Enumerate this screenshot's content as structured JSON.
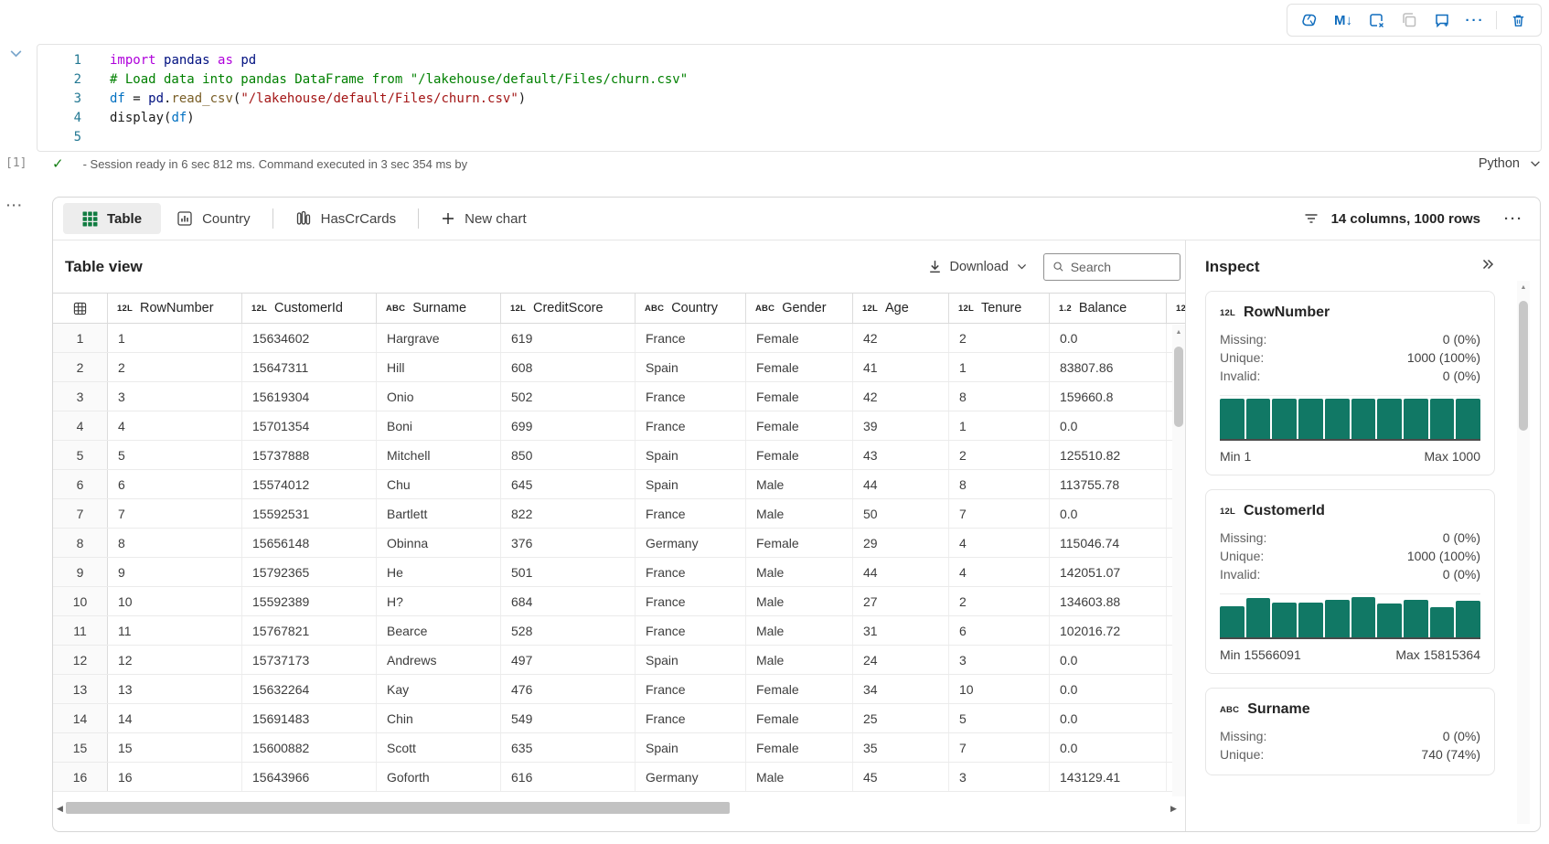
{
  "toolbar": {
    "markdown_label": "M↓",
    "more_label": "···"
  },
  "editor": {
    "lines": [
      {
        "n": "1",
        "tokens": [
          [
            "kw",
            "import"
          ],
          [
            "pl",
            " "
          ],
          [
            "mod",
            "pandas"
          ],
          [
            "pl",
            " "
          ],
          [
            "kw",
            "as"
          ],
          [
            "pl",
            " "
          ],
          [
            "mod",
            "pd"
          ]
        ]
      },
      {
        "n": "2",
        "tokens": [
          [
            "cm",
            "# Load data into pandas DataFrame from \"/lakehouse/default/Files/churn.csv\""
          ]
        ]
      },
      {
        "n": "3",
        "tokens": [
          [
            "var",
            "df"
          ],
          [
            "pl",
            " = "
          ],
          [
            "mod",
            "pd"
          ],
          [
            "pl",
            "."
          ],
          [
            "fn",
            "read_csv"
          ],
          [
            "pl",
            "("
          ],
          [
            "str",
            "\"/lakehouse/default/Files/churn.csv\""
          ],
          [
            "pl",
            ")"
          ]
        ]
      },
      {
        "n": "4",
        "tokens": [
          [
            "pl",
            "display("
          ],
          [
            "var",
            "df"
          ],
          [
            "pl",
            ")"
          ]
        ]
      },
      {
        "n": "5",
        "tokens": []
      }
    ],
    "exec_count": "[1]",
    "status_check": "✓",
    "status_message": "- Session ready in 6 sec 812 ms. Command executed in 3 sec 354 ms by",
    "kernel_label": "Python",
    "cell_more": "···"
  },
  "output": {
    "tabs": {
      "table": "Table",
      "country": "Country",
      "hascrcards": "HasCrCards",
      "new_chart": "New chart"
    },
    "summary_label": "14 columns, 1000 rows",
    "more_label": "···",
    "view": {
      "title": "Table view",
      "download_label": "Download",
      "search_placeholder": "Search"
    },
    "table": {
      "columns": [
        {
          "icon": "grid",
          "label": ""
        },
        {
          "icon": "12L",
          "label": "RowNumber"
        },
        {
          "icon": "12L",
          "label": "CustomerId"
        },
        {
          "icon": "ABC",
          "label": "Surname"
        },
        {
          "icon": "12L",
          "label": "CreditScore"
        },
        {
          "icon": "ABC",
          "label": "Country"
        },
        {
          "icon": "ABC",
          "label": "Gender"
        },
        {
          "icon": "12L",
          "label": "Age"
        },
        {
          "icon": "12L",
          "label": "Tenure"
        },
        {
          "icon": "1.2",
          "label": "Balance"
        },
        {
          "icon": "12L",
          "label": ""
        }
      ],
      "rows": [
        [
          "1",
          "15634602",
          "Hargrave",
          "619",
          "France",
          "Female",
          "42",
          "2",
          "0.0"
        ],
        [
          "2",
          "15647311",
          "Hill",
          "608",
          "Spain",
          "Female",
          "41",
          "1",
          "83807.86"
        ],
        [
          "3",
          "15619304",
          "Onio",
          "502",
          "France",
          "Female",
          "42",
          "8",
          "159660.8"
        ],
        [
          "4",
          "15701354",
          "Boni",
          "699",
          "France",
          "Female",
          "39",
          "1",
          "0.0"
        ],
        [
          "5",
          "15737888",
          "Mitchell",
          "850",
          "Spain",
          "Female",
          "43",
          "2",
          "125510.82"
        ],
        [
          "6",
          "15574012",
          "Chu",
          "645",
          "Spain",
          "Male",
          "44",
          "8",
          "113755.78"
        ],
        [
          "7",
          "15592531",
          "Bartlett",
          "822",
          "France",
          "Male",
          "50",
          "7",
          "0.0"
        ],
        [
          "8",
          "15656148",
          "Obinna",
          "376",
          "Germany",
          "Female",
          "29",
          "4",
          "115046.74"
        ],
        [
          "9",
          "15792365",
          "He",
          "501",
          "France",
          "Male",
          "44",
          "4",
          "142051.07"
        ],
        [
          "10",
          "15592389",
          "H?",
          "684",
          "France",
          "Male",
          "27",
          "2",
          "134603.88"
        ],
        [
          "11",
          "15767821",
          "Bearce",
          "528",
          "France",
          "Male",
          "31",
          "6",
          "102016.72"
        ],
        [
          "12",
          "15737173",
          "Andrews",
          "497",
          "Spain",
          "Male",
          "24",
          "3",
          "0.0"
        ],
        [
          "13",
          "15632264",
          "Kay",
          "476",
          "France",
          "Female",
          "34",
          "10",
          "0.0"
        ],
        [
          "14",
          "15691483",
          "Chin",
          "549",
          "France",
          "Female",
          "25",
          "5",
          "0.0"
        ],
        [
          "15",
          "15600882",
          "Scott",
          "635",
          "Spain",
          "Female",
          "35",
          "7",
          "0.0"
        ],
        [
          "16",
          "15643966",
          "Goforth",
          "616",
          "Germany",
          "Male",
          "45",
          "3",
          "143129.41"
        ]
      ]
    },
    "inspect": {
      "title": "Inspect",
      "cards": [
        {
          "icon": "12L",
          "name": "RowNumber",
          "stats": [
            [
              "Missing:",
              "0 (0%)"
            ],
            [
              "Unique:",
              "1000 (100%)"
            ],
            [
              "Invalid:",
              "0 (0%)"
            ]
          ],
          "hist": [
            1,
            1,
            1,
            1,
            1,
            1,
            1,
            1,
            1,
            1
          ],
          "min": "Min 1",
          "max": "Max 1000"
        },
        {
          "icon": "12L",
          "name": "CustomerId",
          "stats": [
            [
              "Missing:",
              "0 (0%)"
            ],
            [
              "Unique:",
              "1000 (100%)"
            ],
            [
              "Invalid:",
              "0 (0%)"
            ]
          ],
          "hist": [
            0.78,
            0.97,
            0.87,
            0.87,
            0.93,
            1,
            0.84,
            0.94,
            0.76,
            0.9
          ],
          "min": "Min 15566091",
          "max": "Max 15815364"
        },
        {
          "icon": "ABC",
          "name": "Surname",
          "stats": [
            [
              "Missing:",
              "0 (0%)"
            ],
            [
              "Unique:",
              "740 (74%)"
            ]
          ],
          "hist": [],
          "min": "",
          "max": ""
        }
      ]
    }
  },
  "colors": {
    "accent": "#0f6cbd",
    "histogram": "#117865",
    "table_icon_green": "#107c41",
    "check_green": "#107c10"
  }
}
